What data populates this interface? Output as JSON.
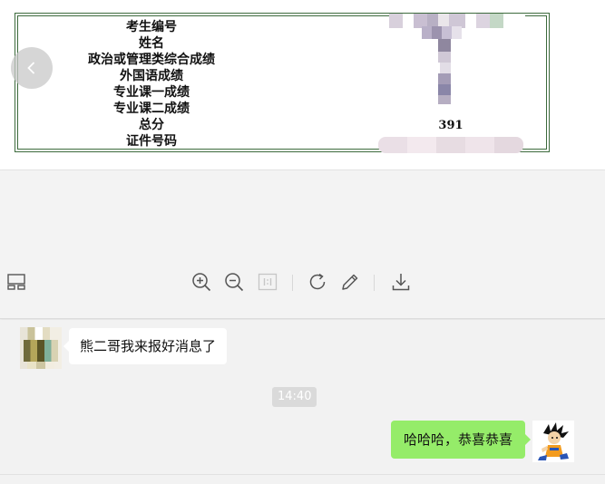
{
  "score_table": {
    "labels": [
      "考生编号",
      "姓名",
      "政治或管理类综合成绩",
      "外国语成绩",
      "专业课一成绩",
      "专业课二成绩",
      "总分",
      "证件号码"
    ],
    "total_value": "391"
  },
  "viewer": {
    "prev_icon": "chevron-left-icon",
    "toolbar_icons": [
      "layout-icon",
      "zoom-in-icon",
      "zoom-out-icon",
      "actual-size-icon",
      "rotate-icon",
      "edit-icon",
      "download-icon"
    ],
    "actual_size_label": "1:1"
  },
  "chat": {
    "incoming_message": "熊二哥我来报好消息了",
    "timestamp": "14:40",
    "outgoing_message": "哈哈哈，恭喜恭喜",
    "outgoing_bubble_color": "#95ec69"
  }
}
